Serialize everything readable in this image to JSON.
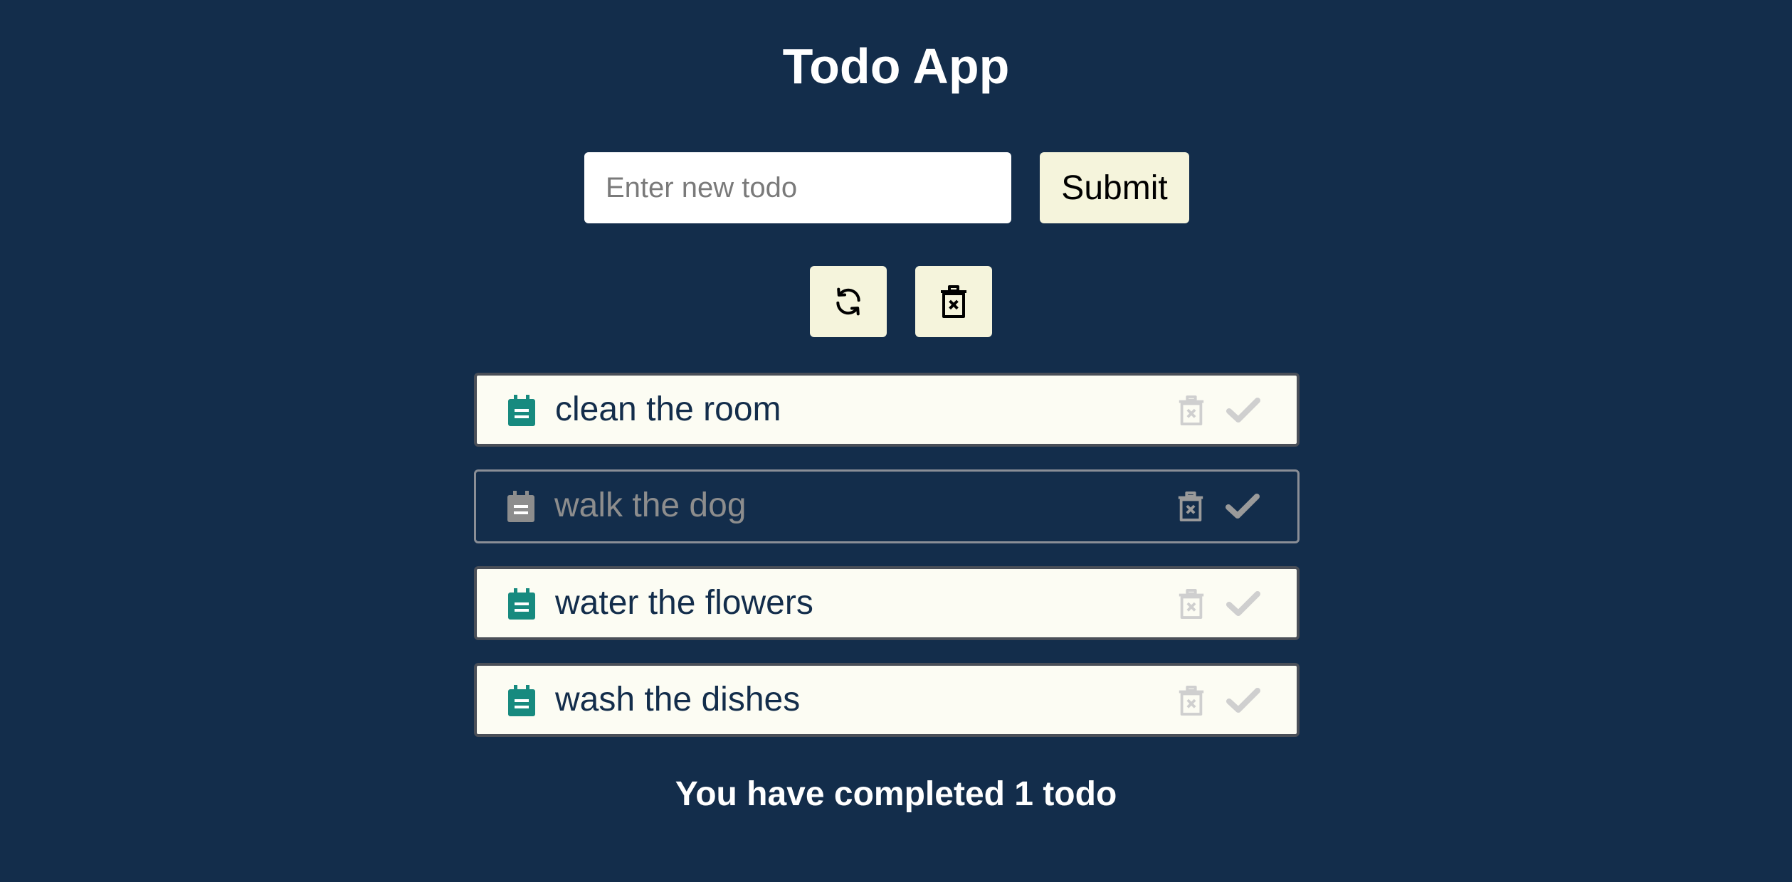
{
  "app": {
    "title": "Todo App"
  },
  "form": {
    "input_value": "",
    "input_placeholder": "Enter new todo",
    "submit_label": "Submit"
  },
  "toolbar": {
    "refresh_icon": "refresh-icon",
    "clear_icon": "trash-x-icon"
  },
  "todos": [
    {
      "text": "clean the room",
      "completed": false
    },
    {
      "text": "walk the dog",
      "completed": true
    },
    {
      "text": "water the flowers",
      "completed": false
    },
    {
      "text": "wash the dishes",
      "completed": false
    }
  ],
  "summary": {
    "text": "You have completed 1 todo"
  },
  "colors": {
    "background": "#132d4b",
    "button_bg": "#f5f4dc",
    "card_bg": "#fcfcf3",
    "clip_icon_active": "#178a7f",
    "clip_icon_completed": "#8d8d8d",
    "action_icon_inactive": "#cfcfcf",
    "action_icon_completed": "#9a9a9a"
  }
}
